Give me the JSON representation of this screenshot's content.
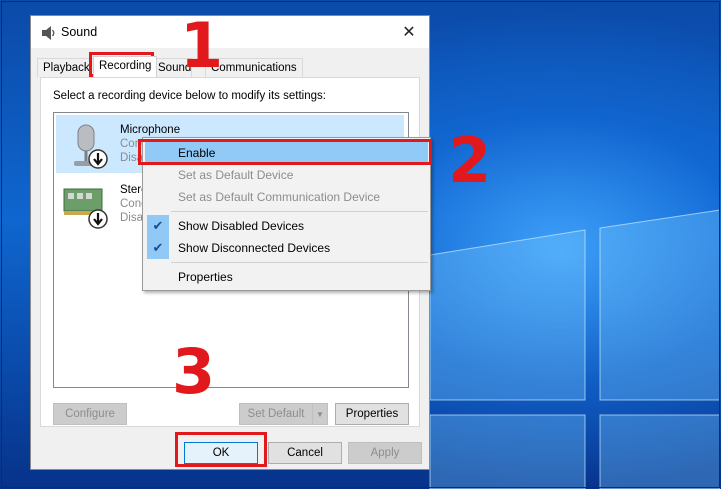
{
  "window": {
    "title": "Sound",
    "close_glyph": "✕"
  },
  "tabs": [
    "Playback",
    "Recording",
    "Sounds",
    "Communications"
  ],
  "active_tab": "Recording",
  "instruction": "Select a recording device below to modify its settings:",
  "devices": [
    {
      "name": "Microphone",
      "line1": "Conexant SmartAudio HD",
      "line2": "Disabled",
      "icon": "microphone-icon",
      "selected": true
    },
    {
      "name": "Stereo Mix",
      "line1": "Conexant SmartAudio HD",
      "line2": "Disabled",
      "icon": "sound-card-icon",
      "selected": false
    }
  ],
  "context_menu": {
    "enable": "Enable",
    "set_default": "Set as Default Device",
    "set_default_comm": "Set as Default Communication Device",
    "show_disabled": "Show Disabled Devices",
    "show_disconnected": "Show Disconnected Devices",
    "properties": "Properties",
    "check_glyph": "✔"
  },
  "panel_buttons": {
    "configure": "Configure",
    "set_default": "Set Default",
    "properties": "Properties"
  },
  "dialog_buttons": {
    "ok": "OK",
    "cancel": "Cancel",
    "apply": "Apply"
  },
  "annotations": {
    "step1": "1",
    "step2": "2",
    "step3": "3",
    "color": "#e2191c"
  },
  "icons": {
    "window": "speaker-icon",
    "status": "down-arrow-badge-icon"
  }
}
